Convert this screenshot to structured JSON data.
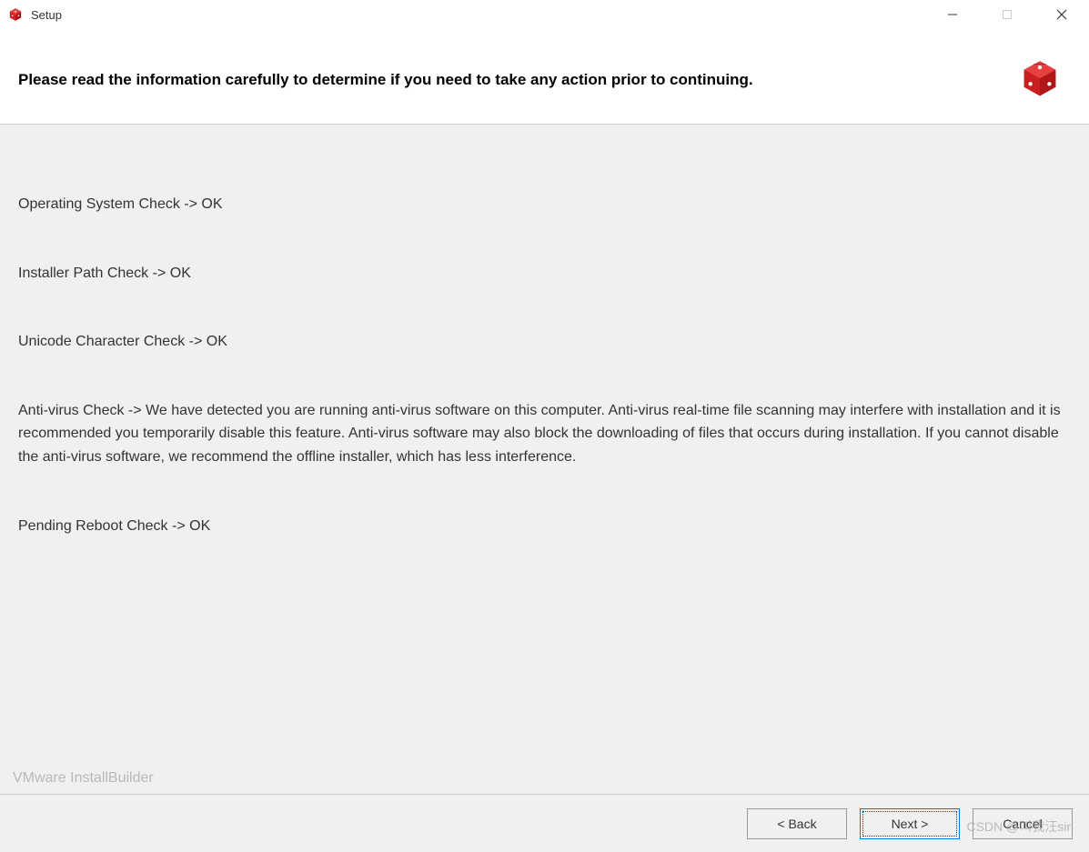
{
  "titlebar": {
    "title": "Setup"
  },
  "header": {
    "instruction": "Please read the information carefully to determine if you need to take any action prior to continuing."
  },
  "checks": [
    "Operating System Check -> OK",
    "Installer Path Check -> OK",
    "Unicode Character Check ->  OK",
    "Anti-virus Check -> We have detected you are running anti-virus software on this computer. Anti-virus real-time file scanning may interfere with installation and it is recommended you temporarily disable this feature. Anti-virus software may also block the downloading of files that occurs during installation. If you cannot disable the anti-virus software, we recommend the offline installer, which has less interference.",
    "Pending Reboot Check -> OK"
  ],
  "footer": {
    "brand": "VMware InstallBuilder"
  },
  "buttons": {
    "back": "< Back",
    "next": "Next >",
    "cancel": "Cancel"
  },
  "watermark": "CSDN @叫我汪sir"
}
